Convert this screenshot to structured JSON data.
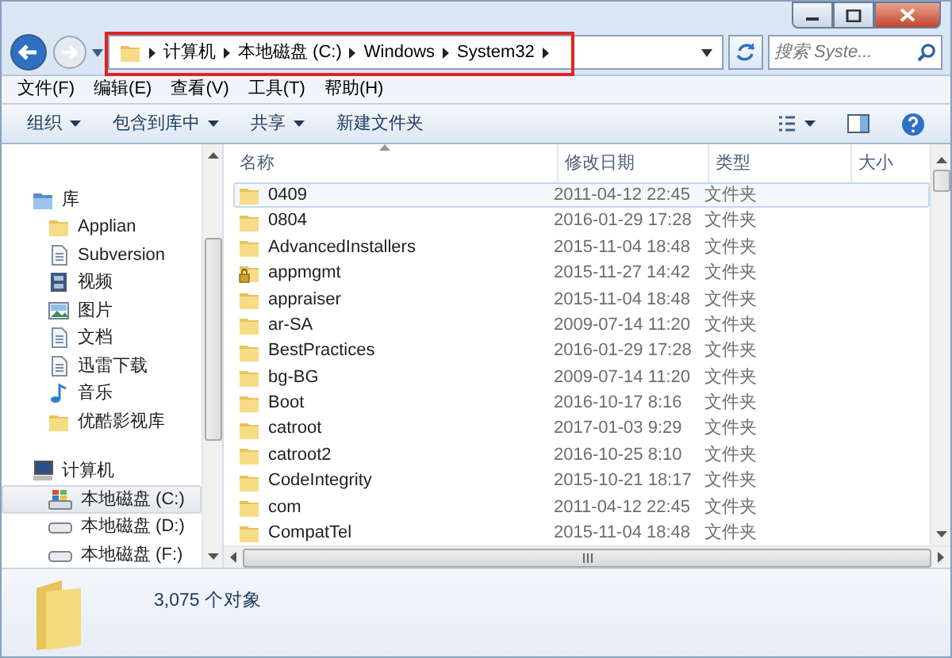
{
  "navigation": {
    "back_disabled": false,
    "forward_disabled": true
  },
  "address_bar": {
    "crumbs": [
      "计算机",
      "本地磁盘 (C:)",
      "Windows",
      "System32"
    ]
  },
  "search": {
    "placeholder": "搜索 Syste..."
  },
  "menu_bar": [
    "文件(F)",
    "编辑(E)",
    "查看(V)",
    "工具(T)",
    "帮助(H)"
  ],
  "toolbar": [
    {
      "label": "组织",
      "dropdown": true
    },
    {
      "label": "包含到库中",
      "dropdown": true
    },
    {
      "label": "共享",
      "dropdown": true
    },
    {
      "label": "新建文件夹",
      "dropdown": false
    }
  ],
  "sidebar": {
    "items": [
      {
        "label": "库",
        "kind": "library",
        "header": true,
        "selected": false
      },
      {
        "label": "Applian",
        "kind": "folder",
        "header": false,
        "selected": false
      },
      {
        "label": "Subversion",
        "kind": "document",
        "header": false,
        "selected": false
      },
      {
        "label": "视频",
        "kind": "video",
        "header": false,
        "selected": false
      },
      {
        "label": "图片",
        "kind": "picture",
        "header": false,
        "selected": false
      },
      {
        "label": "文档",
        "kind": "document",
        "header": false,
        "selected": false
      },
      {
        "label": "迅雷下载",
        "kind": "document",
        "header": false,
        "selected": false
      },
      {
        "label": "音乐",
        "kind": "music",
        "header": false,
        "selected": false
      },
      {
        "label": "优酷影视库",
        "kind": "folder",
        "header": false,
        "selected": false
      },
      {
        "label": "计算机",
        "kind": "computer",
        "header": true,
        "selected": false
      },
      {
        "label": "本地磁盘 (C:)",
        "kind": "system-drive",
        "header": false,
        "selected": true
      },
      {
        "label": "本地磁盘 (D:)",
        "kind": "drive",
        "header": false,
        "selected": false
      },
      {
        "label": "本地磁盘 (F:)",
        "kind": "drive",
        "header": false,
        "selected": false
      }
    ]
  },
  "file_list": {
    "columns": [
      {
        "label": "名称",
        "sorted": true
      },
      {
        "label": "修改日期",
        "sorted": false
      },
      {
        "label": "类型",
        "sorted": false
      },
      {
        "label": "大小",
        "sorted": false
      }
    ],
    "rows": [
      {
        "name": "0409",
        "date": "2011-04-12 22:45",
        "type": "文件夹",
        "locked": false,
        "selected": true
      },
      {
        "name": "0804",
        "date": "2016-01-29 17:28",
        "type": "文件夹",
        "locked": false,
        "selected": false
      },
      {
        "name": "AdvancedInstallers",
        "date": "2015-11-04 18:48",
        "type": "文件夹",
        "locked": false,
        "selected": false
      },
      {
        "name": "appmgmt",
        "date": "2015-11-27 14:42",
        "type": "文件夹",
        "locked": true,
        "selected": false
      },
      {
        "name": "appraiser",
        "date": "2015-11-04 18:48",
        "type": "文件夹",
        "locked": false,
        "selected": false
      },
      {
        "name": "ar-SA",
        "date": "2009-07-14 11:20",
        "type": "文件夹",
        "locked": false,
        "selected": false
      },
      {
        "name": "BestPractices",
        "date": "2016-01-29 17:28",
        "type": "文件夹",
        "locked": false,
        "selected": false
      },
      {
        "name": "bg-BG",
        "date": "2009-07-14 11:20",
        "type": "文件夹",
        "locked": false,
        "selected": false
      },
      {
        "name": "Boot",
        "date": "2016-10-17 8:16",
        "type": "文件夹",
        "locked": false,
        "selected": false
      },
      {
        "name": "catroot",
        "date": "2017-01-03 9:29",
        "type": "文件夹",
        "locked": false,
        "selected": false
      },
      {
        "name": "catroot2",
        "date": "2016-10-25 8:10",
        "type": "文件夹",
        "locked": false,
        "selected": false
      },
      {
        "name": "CodeIntegrity",
        "date": "2015-10-21 18:17",
        "type": "文件夹",
        "locked": false,
        "selected": false
      },
      {
        "name": "com",
        "date": "2011-04-12 22:45",
        "type": "文件夹",
        "locked": false,
        "selected": false
      },
      {
        "name": "CompatTel",
        "date": "2015-11-04 18:48",
        "type": "文件夹",
        "locked": false,
        "selected": false
      }
    ]
  },
  "status_bar": {
    "text": "3,075 个对象"
  }
}
